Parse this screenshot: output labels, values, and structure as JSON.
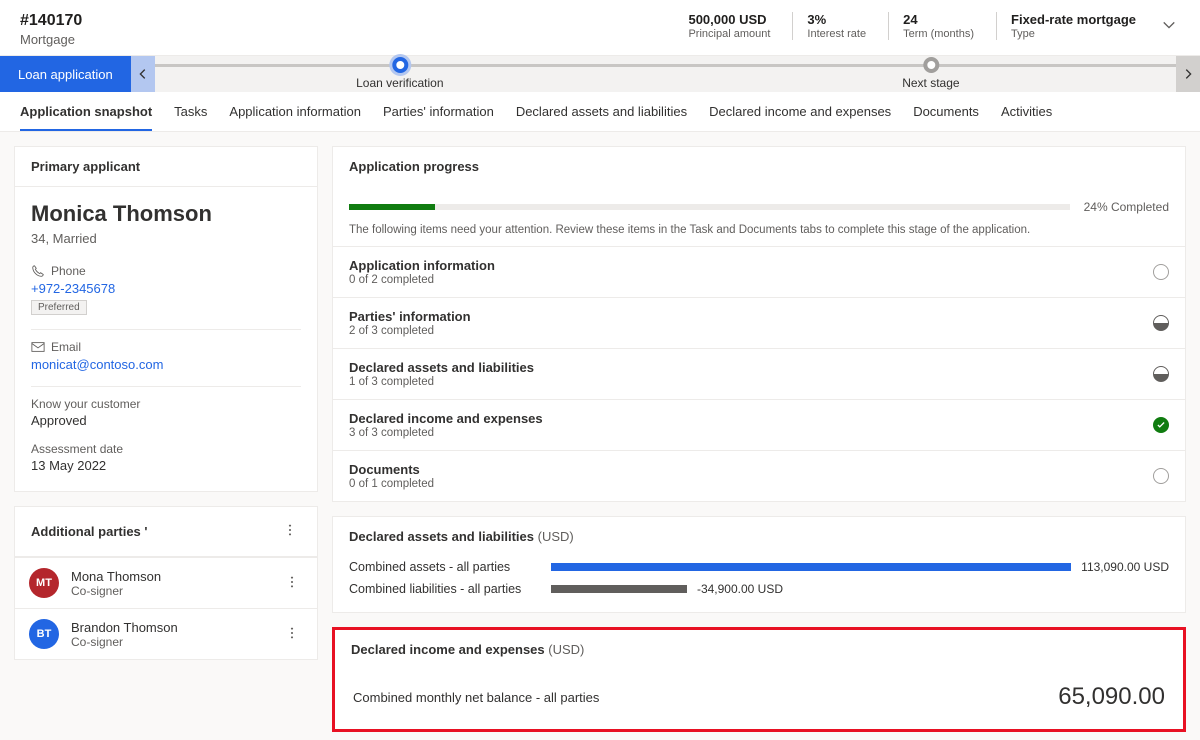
{
  "header": {
    "id": "#140170",
    "type": "Mortgage",
    "metrics": [
      {
        "val": "500,000 USD",
        "lab": "Principal amount"
      },
      {
        "val": "3%",
        "lab": "Interest rate"
      },
      {
        "val": "24",
        "lab": "Term (months)"
      },
      {
        "val": "Fixed-rate mortgage",
        "lab": "Type"
      }
    ]
  },
  "stages": {
    "current": "Loan application",
    "mid": "Loan verification",
    "next": "Next stage"
  },
  "tabs": [
    "Application snapshot",
    "Tasks",
    "Application information",
    "Parties' information",
    "Declared assets and liabilities",
    "Declared income and expenses",
    "Documents",
    "Activities"
  ],
  "applicant": {
    "card_title": "Primary applicant",
    "name": "Monica Thomson",
    "sub": "34, Married",
    "phone_label": "Phone",
    "phone": "+972-2345678",
    "preferred": "Preferred",
    "email_label": "Email",
    "email": "monicat@contoso.com",
    "kyc_label": "Know your customer",
    "kyc_val": "Approved",
    "assess_label": "Assessment date",
    "assess_val": "13 May 2022"
  },
  "parties": {
    "title": "Additional parties '",
    "list": [
      {
        "initials": "MT",
        "name": "Mona Thomson",
        "role": "Co-signer",
        "color": "#b4262c"
      },
      {
        "initials": "BT",
        "name": "Brandon Thomson",
        "role": "Co-signer",
        "color": "#2266E3"
      }
    ]
  },
  "progress": {
    "title": "Application progress",
    "pct": 24,
    "pct_text": "24% Completed",
    "note": "The following items need your attention. Review these items in the Task and Documents tabs to complete this stage of the application.",
    "items": [
      {
        "t": "Application information",
        "s": "0 of 2 completed",
        "status": "empty"
      },
      {
        "t": "Parties' information",
        "s": "2 of 3 completed",
        "status": "partial"
      },
      {
        "t": "Declared assets and liabilities",
        "s": "1 of 3 completed",
        "status": "partial"
      },
      {
        "t": "Declared income and expenses",
        "s": "3 of 3 completed",
        "status": "done"
      },
      {
        "t": "Documents",
        "s": "0 of 1 completed",
        "status": "empty"
      }
    ]
  },
  "assets": {
    "title": "Declared assets and liabilities",
    "unit": "(USD)",
    "rows": [
      {
        "label": "Combined assets - all parties",
        "val": "113,090.00 USD",
        "width": 100,
        "color": "#2266E3"
      },
      {
        "label": "Combined liabilities - all parties",
        "val": "-34,900.00 USD",
        "width": 24,
        "color": "#605e5c"
      }
    ]
  },
  "income": {
    "title": "Declared income and expenses",
    "unit": "(USD)",
    "net_label": "Combined monthly net balance - all parties",
    "net_val": "65,090.00"
  }
}
